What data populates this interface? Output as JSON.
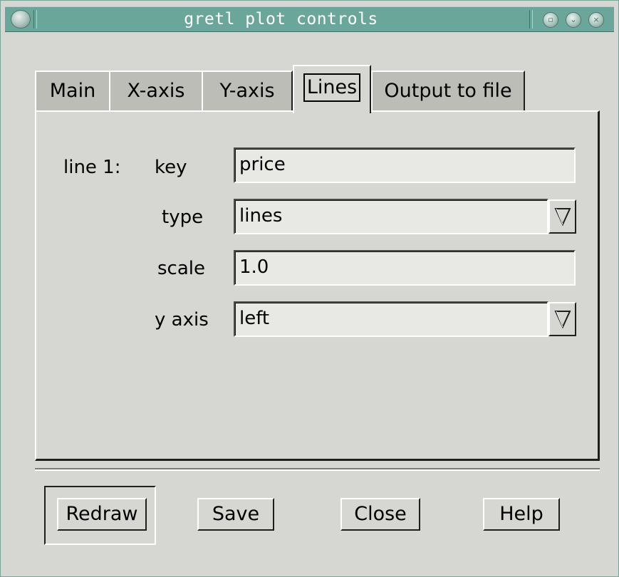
{
  "window": {
    "title": "gretl plot controls",
    "icon": "app-menu-icon",
    "wm_buttons": [
      "minimize-icon",
      "shade-icon",
      "close-icon"
    ]
  },
  "tabs": [
    {
      "label": "Main",
      "active": false
    },
    {
      "label": "X-axis",
      "active": false
    },
    {
      "label": "Y-axis",
      "active": false
    },
    {
      "label": "Lines",
      "active": true
    },
    {
      "label": "Output to file",
      "active": false
    }
  ],
  "lines_page": {
    "line_label": "line 1:",
    "key_label": "key",
    "key_value": "price",
    "type_label": "type",
    "type_value": "lines",
    "scale_label": "scale",
    "scale_value": "1.0",
    "yaxis_label": "y axis",
    "yaxis_value": "left"
  },
  "buttons": {
    "redraw": "Redraw",
    "save": "Save",
    "close": "Close",
    "help": "Help"
  },
  "colors": {
    "titlebar": "#6aa79a",
    "background": "#d6d7d2"
  }
}
